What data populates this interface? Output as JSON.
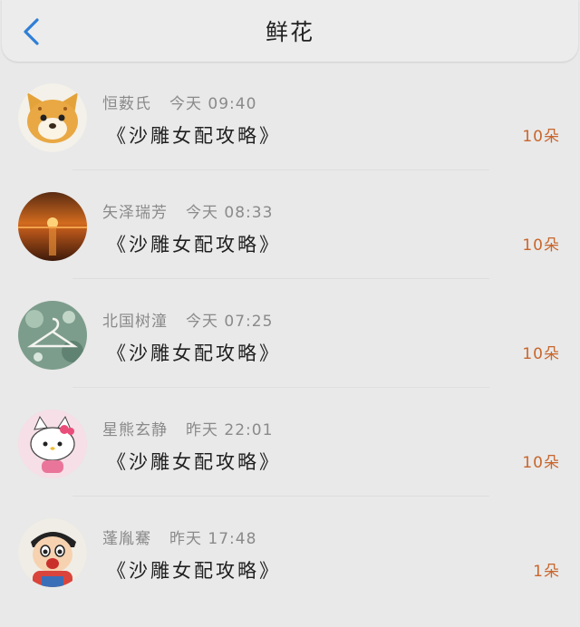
{
  "header": {
    "title": "鲜花"
  },
  "colors": {
    "accent": "#2f7fd6",
    "count": "#c8662c"
  },
  "items": [
    {
      "name": "恒薮氏",
      "time": "今天 09:40",
      "message": "《沙雕女配攻略》",
      "count": "10朵",
      "avatar": "fox-avatar"
    },
    {
      "name": "矢泽瑞芳",
      "time": "今天 08:33",
      "message": "《沙雕女配攻略》",
      "count": "10朵",
      "avatar": "sunset-avatar"
    },
    {
      "name": "北国树潼",
      "time": "今天 07:25",
      "message": "《沙雕女配攻略》",
      "count": "10朵",
      "avatar": "hanger-avatar"
    },
    {
      "name": "星熊玄静",
      "time": "昨天 22:01",
      "message": "《沙雕女配攻略》",
      "count": "10朵",
      "avatar": "hello-kitty-avatar"
    },
    {
      "name": "蓬胤騫",
      "time": "昨天 17:48",
      "message": "《沙雕女配攻略》",
      "count": "1朵",
      "avatar": "crayon-shin-chan-avatar"
    }
  ]
}
